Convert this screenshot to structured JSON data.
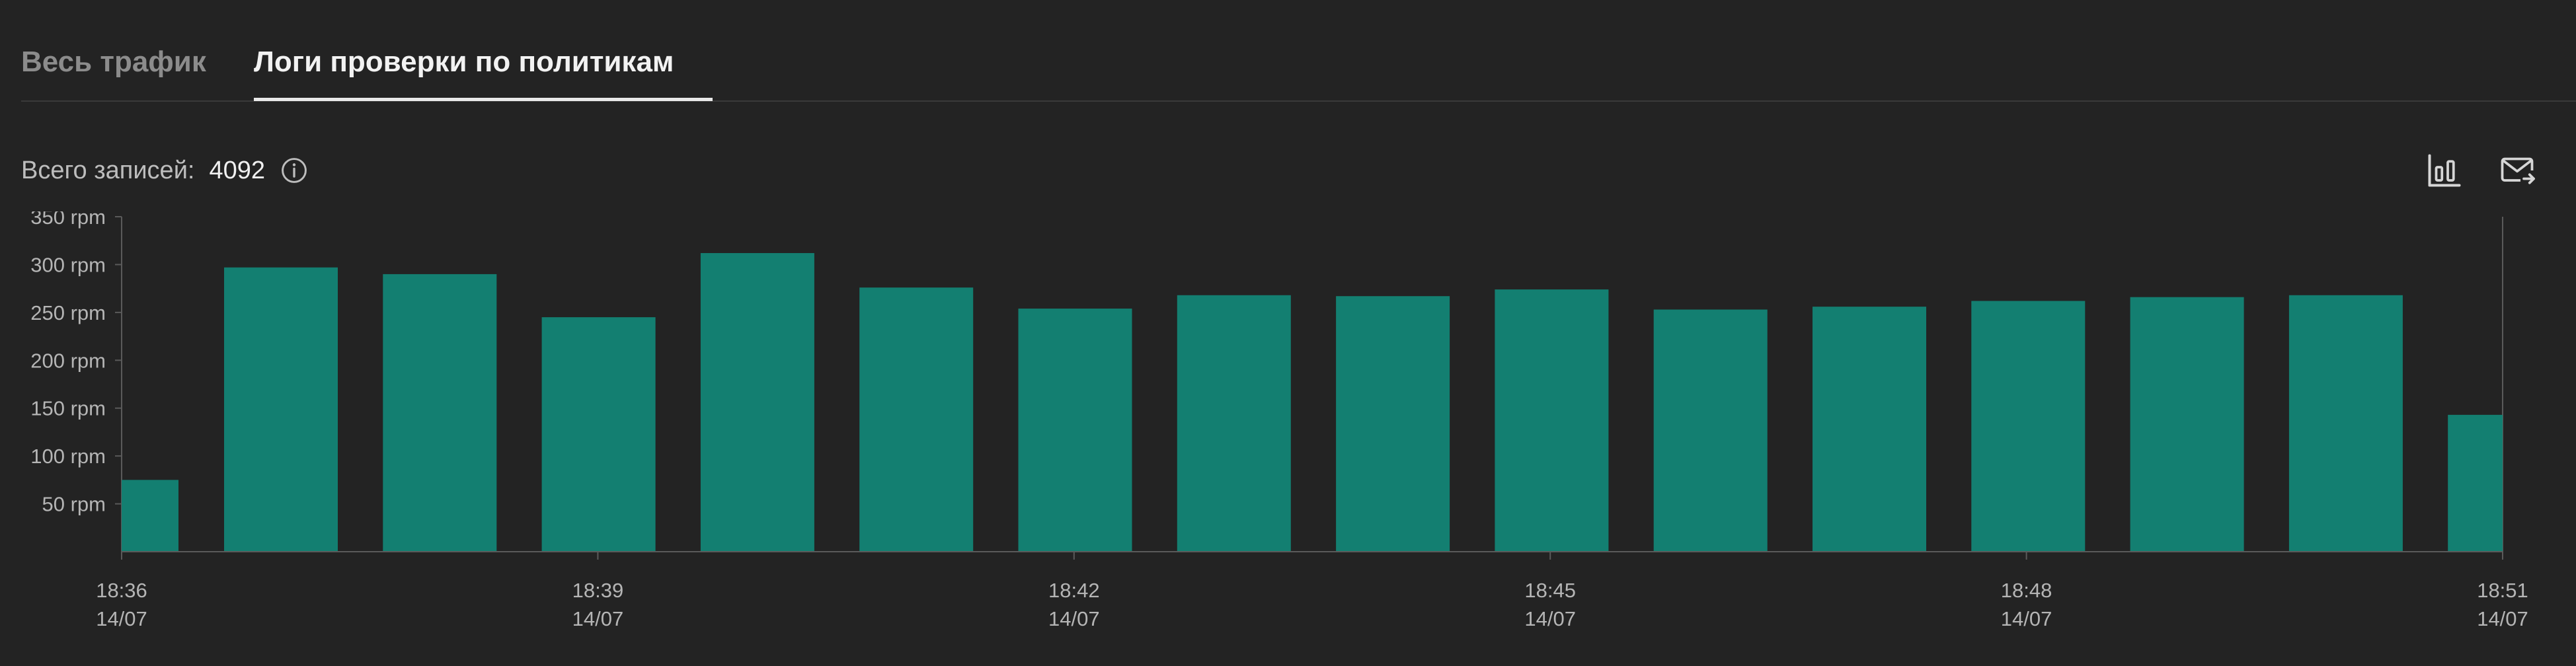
{
  "tabs": {
    "all_traffic": "Весь трафик",
    "policy_logs": "Логи проверки по политикам"
  },
  "summary": {
    "label": "Всего записей:",
    "count": "4092"
  },
  "colors": {
    "background": "#232323",
    "bar": "#137f71",
    "axis": "#5a5a5a",
    "tick_text": "#b5b5b5",
    "tab_active": "#f2f2f2",
    "tab_inactive": "#8c8c8c"
  },
  "icons": {
    "info": "info-icon",
    "chart_toggle": "bar-chart-icon",
    "mail_export": "mail-export-icon"
  },
  "chart_data": {
    "type": "bar",
    "title": "",
    "xlabel": "",
    "ylabel": "",
    "ylim": [
      0,
      350
    ],
    "y_ticks": [
      {
        "value": 50,
        "label": "50 rpm"
      },
      {
        "value": 100,
        "label": "100 rpm"
      },
      {
        "value": 150,
        "label": "150 rpm"
      },
      {
        "value": 200,
        "label": "200 rpm"
      },
      {
        "value": 250,
        "label": "250 rpm"
      },
      {
        "value": 300,
        "label": "300 rpm"
      },
      {
        "value": 350,
        "label": "350 rpm"
      }
    ],
    "x_ticks": [
      {
        "minute": 0,
        "time": "18:36",
        "date": "14/07"
      },
      {
        "minute": 3,
        "time": "18:39",
        "date": "14/07"
      },
      {
        "minute": 6,
        "time": "18:42",
        "date": "14/07"
      },
      {
        "minute": 9,
        "time": "18:45",
        "date": "14/07"
      },
      {
        "minute": 12,
        "time": "18:48",
        "date": "14/07"
      },
      {
        "minute": 15,
        "time": "18:51",
        "date": "14/07"
      }
    ],
    "categories": [
      "18:36",
      "18:37",
      "18:38",
      "18:39",
      "18:40",
      "18:41",
      "18:42",
      "18:43",
      "18:44",
      "18:45",
      "18:46",
      "18:47",
      "18:48",
      "18:49",
      "18:50",
      "18:51"
    ],
    "values": [
      75,
      297,
      290,
      245,
      312,
      276,
      254,
      268,
      267,
      274,
      253,
      256,
      262,
      266,
      268,
      143
    ],
    "grid": false,
    "legend": "none"
  }
}
